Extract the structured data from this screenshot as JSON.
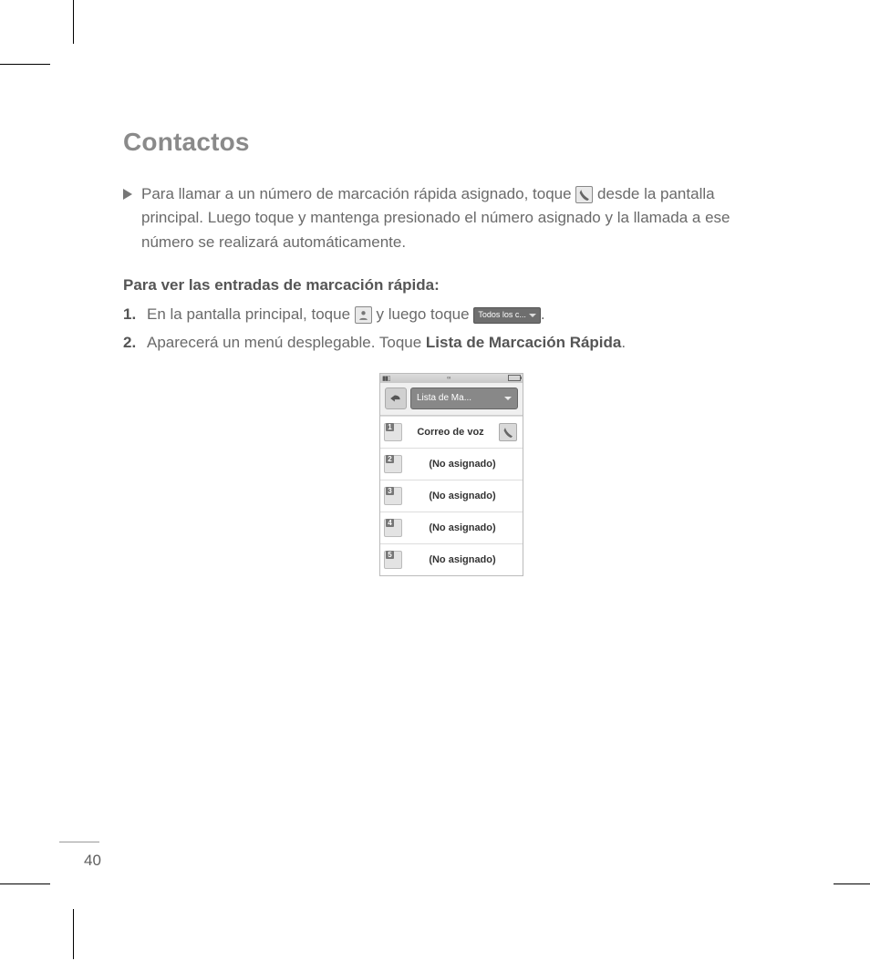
{
  "page_number": "40",
  "heading": "Contactos",
  "intro": {
    "text": "Para llamar a un número de marcación rápida asignado, toque ",
    "after_icon": " desde la pantalla principal. Luego toque y mantenga presionado el número asignado y la llamada a ese número se realizará automáticamente."
  },
  "subheading": "Para ver las entradas de marcación rápida:",
  "steps": [
    {
      "num": "1.",
      "pre": " En la pantalla principal, toque ",
      "mid": " y luego toque ",
      "chip_label": "Todos los c...",
      "post": "."
    },
    {
      "num": "2.",
      "pre": "Aparecerá un menú desplegable. Toque ",
      "bold": "Lista de Marcación Rápida",
      "post": "."
    }
  ],
  "phone": {
    "dropdown_label": "Lista de Ma...",
    "rows": [
      {
        "key": "1",
        "label": "Correo de voz",
        "has_call": true
      },
      {
        "key": "2",
        "label": "(No asignado)",
        "has_call": false
      },
      {
        "key": "3",
        "label": "(No asignado)",
        "has_call": false
      },
      {
        "key": "4",
        "label": "(No asignado)",
        "has_call": false
      },
      {
        "key": "5",
        "label": "(No asignado)",
        "has_call": false
      }
    ]
  }
}
